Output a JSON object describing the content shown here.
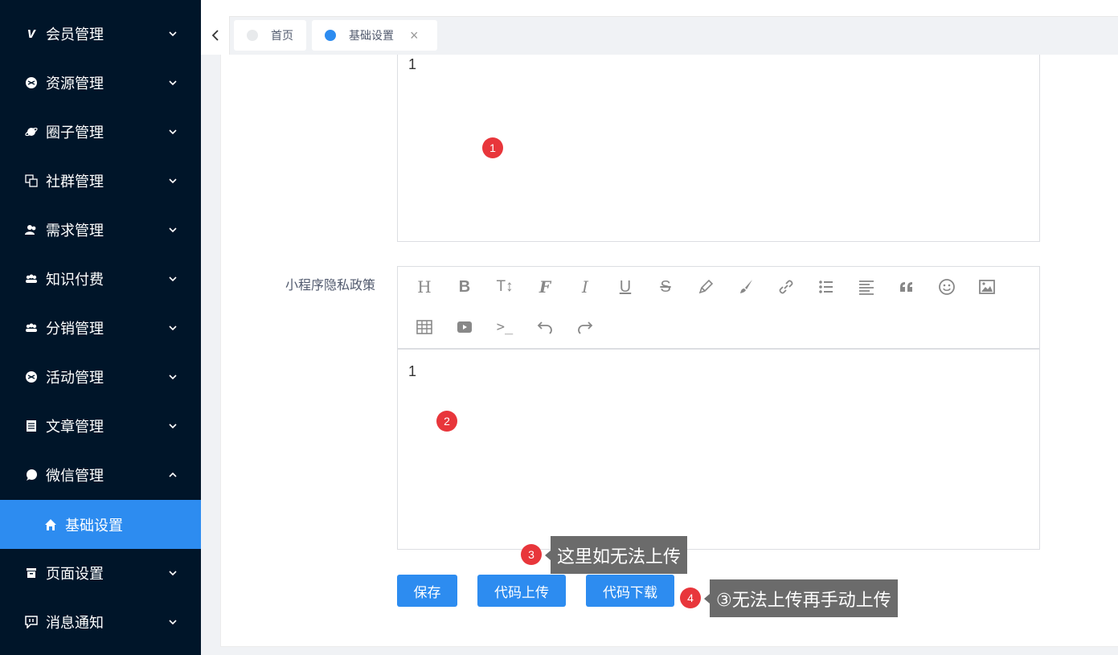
{
  "sidebar": {
    "items": [
      {
        "label": "会员管理",
        "icon": "vip-icon"
      },
      {
        "label": "资源管理",
        "icon": "resource-icon"
      },
      {
        "label": "圈子管理",
        "icon": "planet-icon"
      },
      {
        "label": "社群管理",
        "icon": "copy-icon"
      },
      {
        "label": "需求管理",
        "icon": "users-icon"
      },
      {
        "label": "知识付费",
        "icon": "group-icon"
      },
      {
        "label": "分销管理",
        "icon": "group-icon"
      },
      {
        "label": "活动管理",
        "icon": "resource-icon"
      },
      {
        "label": "文章管理",
        "icon": "article-icon"
      },
      {
        "label": "微信管理",
        "icon": "wechat-icon"
      },
      {
        "label": "基础设置",
        "icon": "home-icon"
      },
      {
        "label": "页面设置",
        "icon": "archive-icon"
      },
      {
        "label": "消息通知",
        "icon": "message-icon"
      }
    ]
  },
  "tabs": [
    {
      "label": "首页"
    },
    {
      "label": "基础设置",
      "close": "×"
    }
  ],
  "editors": {
    "first_content": "1",
    "second_label": "小程序隐私政策",
    "second_content": "1"
  },
  "toolbar": {
    "row1": [
      "H",
      "B",
      "T↕",
      "F",
      "I",
      "U",
      "S",
      "pen",
      "brush",
      "link",
      "list",
      "align",
      "quote",
      "emoji",
      "image"
    ],
    "row2": [
      "table",
      "video",
      "code",
      "undo",
      "redo"
    ]
  },
  "annotations": {
    "badge1": "1",
    "badge2": "2",
    "badge3": "3",
    "badge4": "4",
    "callout3": "这里如无法上传",
    "callout4": "③无法上传再手动上传"
  },
  "buttons": {
    "save": "保存",
    "upload": "代码上传",
    "download": "代码下载"
  },
  "colors": {
    "sidebar_bg": "#001529",
    "accent": "#2d8cf0",
    "badge": "#e8363b",
    "callout": "#6b6b6b"
  }
}
